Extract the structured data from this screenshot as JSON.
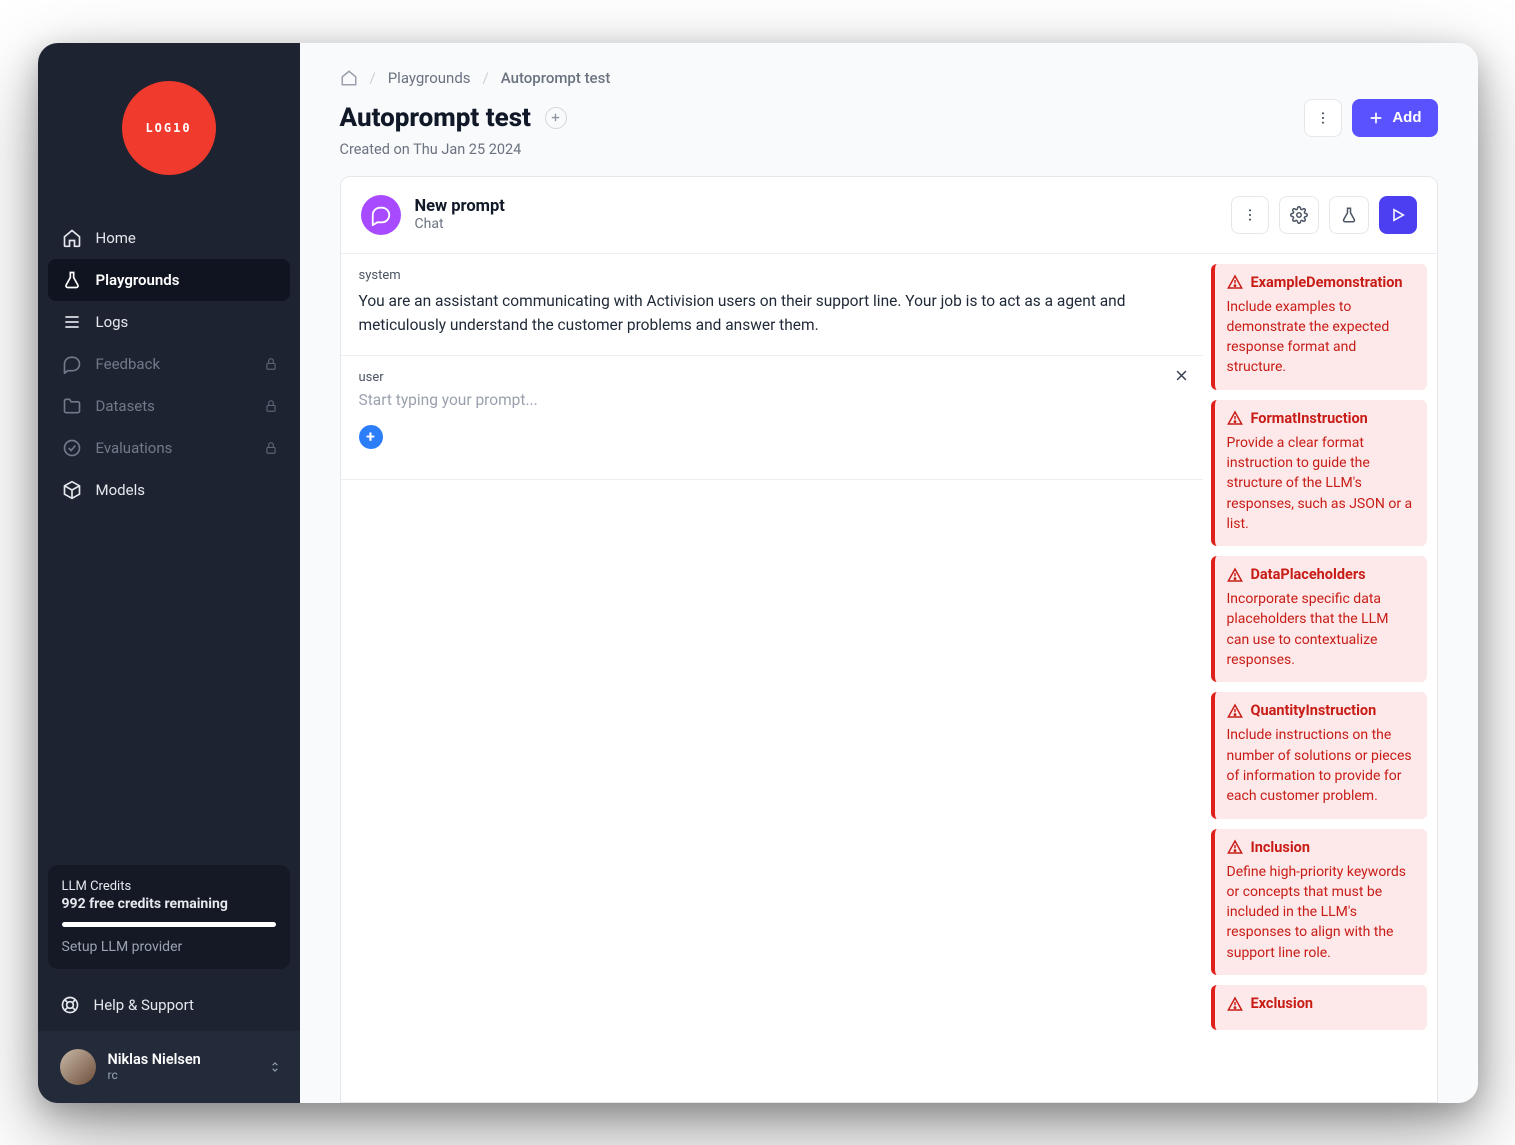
{
  "brand": {
    "logo_text": "LOG10"
  },
  "sidebar": {
    "items": [
      {
        "label": "Home",
        "icon": "home-icon"
      },
      {
        "label": "Playgrounds",
        "icon": "flask-icon"
      },
      {
        "label": "Logs",
        "icon": "list-icon"
      },
      {
        "label": "Feedback",
        "icon": "chat-icon"
      },
      {
        "label": "Datasets",
        "icon": "folder-icon"
      },
      {
        "label": "Evaluations",
        "icon": "check-circle-icon"
      },
      {
        "label": "Models",
        "icon": "cube-icon"
      }
    ],
    "help_label": "Help & Support"
  },
  "credits": {
    "title": "LLM Credits",
    "remaining": "992 free credits remaining",
    "setup": "Setup LLM provider"
  },
  "user": {
    "name": "Niklas Nielsen",
    "org": "rc"
  },
  "breadcrumb": {
    "items": [
      "Playgrounds",
      "Autoprompt test"
    ]
  },
  "page": {
    "title": "Autoprompt test",
    "created": "Created on Thu Jan 25 2024",
    "add_label": "Add"
  },
  "prompt": {
    "name": "New prompt",
    "type": "Chat",
    "messages": {
      "system_role": "system",
      "system_text": "You are an assistant communicating with Activision users on their support line. Your job is to act as a agent and meticulously understand the customer problems and answer them.",
      "user_role": "user",
      "user_placeholder": "Start typing your prompt..."
    }
  },
  "hints": [
    {
      "title": "ExampleDemonstration",
      "body": "Include examples to demonstrate the expected response format and structure."
    },
    {
      "title": "FormatInstruction",
      "body": "Provide a clear format instruction to guide the structure of the LLM's responses, such as JSON or a list."
    },
    {
      "title": "DataPlaceholders",
      "body": "Incorporate specific data placeholders that the LLM can use to contextualize responses."
    },
    {
      "title": "QuantityInstruction",
      "body": "Include instructions on the number of solutions or pieces of information to provide for each customer problem."
    },
    {
      "title": "Inclusion",
      "body": "Define high-priority keywords or concepts that must be included in the LLM's responses to align with the support line role."
    },
    {
      "title": "Exclusion",
      "body": ""
    }
  ]
}
